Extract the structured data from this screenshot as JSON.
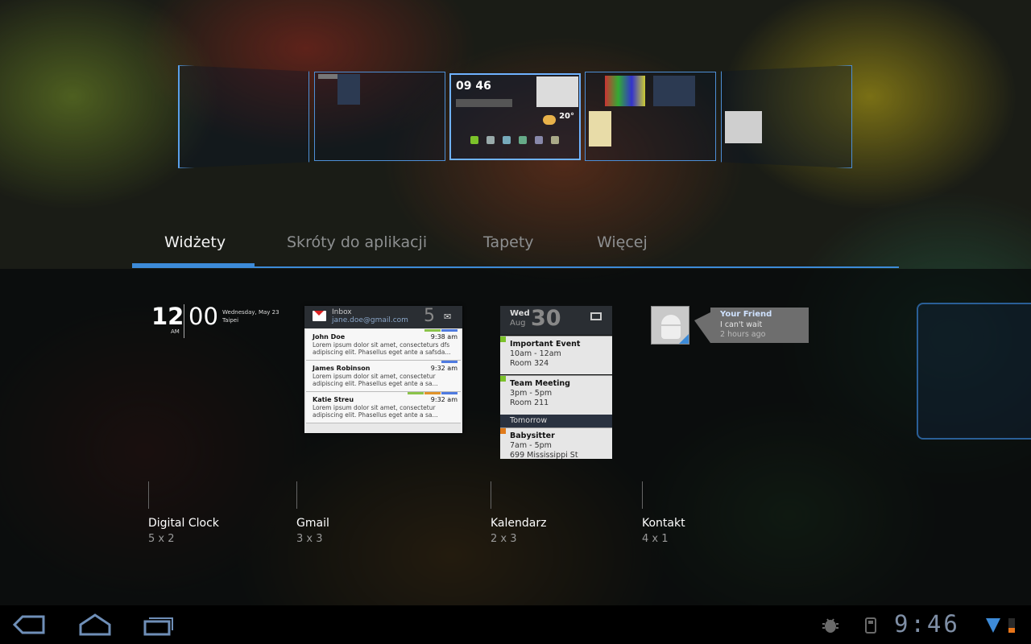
{
  "workspace_preview": {
    "clock_text": "09 46",
    "temperature": "20°"
  },
  "tabs": [
    {
      "label": "Widżety",
      "active": true
    },
    {
      "label": "Skróty do aplikacji",
      "active": false
    },
    {
      "label": "Tapety",
      "active": false
    },
    {
      "label": "Więcej",
      "active": false
    }
  ],
  "widgets": {
    "digital_clock": {
      "hour": "12",
      "minute": "00",
      "ampm": "AM",
      "date": "Wednesday, May 23",
      "city": "Taipei",
      "name": "Digital Clock",
      "size": "5 x 2"
    },
    "gmail": {
      "folder": "Inbox",
      "account": "jane.doe@gmail.com",
      "unread": "5",
      "messages": [
        {
          "from": "John Doe",
          "time": "9:38 am",
          "snippet": "Lorem ipsum dolor sit amet, consecteturs dfs adipiscing elit. Phasellus eget ante a safsda..."
        },
        {
          "from": "James Robinson",
          "time": "9:32 am",
          "snippet": "Lorem ipsum dolor sit amet, consectetur adipiscing elit. Phasellus eget ante a sa..."
        },
        {
          "from": "Katie Streu",
          "time": "9:32 am",
          "snippet": "Lorem ipsum dolor sit amet, consectetur adipiscing elit. Phasellus eget ante a sa..."
        }
      ],
      "name": "Gmail",
      "size": "3 x 3"
    },
    "calendar": {
      "weekday": "Wed",
      "month": "Aug",
      "day": "30",
      "events": [
        {
          "title": "Important Event",
          "time": "10am - 12am",
          "place": "Room 324",
          "color": "#7cc22a"
        },
        {
          "title": "Team Meeting",
          "time": "3pm - 5pm",
          "place": "Room 211",
          "color": "#7cc22a"
        },
        {
          "title": "Babysitter",
          "time": "7am - 5pm",
          "place": "699 Mississippi St",
          "color": "#e07a1a"
        }
      ],
      "tomorrow_label": "Tomorrow",
      "name": "Kalendarz",
      "size": "2 x 3"
    },
    "contact": {
      "name": "Your Friend",
      "message": "I can't wait",
      "ago": "2 hours ago",
      "widget_name": "Kontakt",
      "size": "4 x 1"
    }
  },
  "system_bar": {
    "icons": [
      "back-icon",
      "home-icon",
      "recent-apps-icon",
      "android-debug-icon",
      "usb-icon",
      "wifi-signal-icon",
      "battery-icon"
    ],
    "time": "9:46",
    "accent": "#3d8bd8"
  }
}
